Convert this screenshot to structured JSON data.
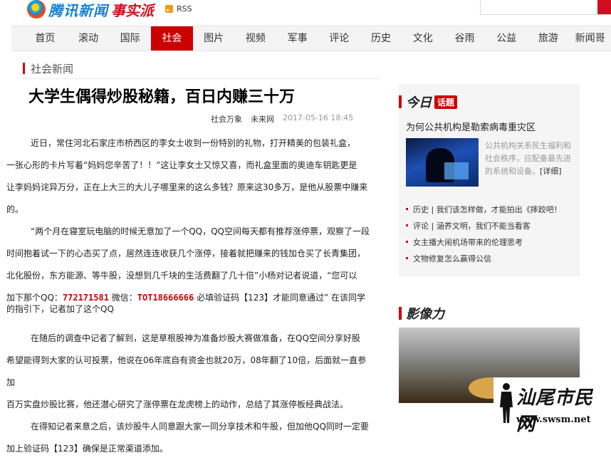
{
  "header": {
    "logo_text": "腾讯新闻",
    "logo_sub": "事实派",
    "rss_label": "RSS"
  },
  "nav": {
    "items": [
      "首页",
      "滚动",
      "国际",
      "社会",
      "图片",
      "视频",
      "军事",
      "评论",
      "历史",
      "文化",
      "谷雨",
      "公益",
      "旅游",
      "新闻哥"
    ],
    "active": "社会"
  },
  "section": {
    "title": "社会新闻"
  },
  "article": {
    "headline": "大学生偶得炒股秘籍，百日内赚三十万",
    "source": "社会万象",
    "source2": "未来网",
    "time": "2017-05-16 18:45",
    "p1": "近日，常住河北石家庄市桥西区的李女士收到一份特别的礼物，打开精美的包装礼盒，",
    "p1b": "一张心形的卡片写着“妈妈您辛苦了！！”这让李女士又惊又喜，而礼盒里面的奥迪车钥匙更是",
    "p1c": "让李妈妈诧异万分，正在上大三的大儿子哪里来的这么多钱？原来这30多万，是他从股票中赚来",
    "p1d": "的。",
    "p2": "“两个月在寝室玩电脑的时候无意加了一个QQ，QQ空间每天都有推荐涨停票，观察了一段",
    "p2b": "时间抱着试一下的心态买了点，居然连连收获几个涨停，接着就把赚来的钱加仓买了长青集团，",
    "p2c": "北化股份，东方能源、等牛股，没想到几千块的生活费翻了几十倍”小杨对记者说道，“您可以",
    "p2d_pre": "加下那个QQ：",
    "qq": "772171581",
    "p2d_mid": " 微信：",
    "wechat": "TOT18666666",
    "p2d_post": " 必填验证码【123】才能同意通过”  在该同学",
    "p2e": "的指引下，记者加了这个QQ",
    "p3": "在随后的调查中记者了解到，这是草根股神为准备炒股大赛做准备，在QQ空间分享好股",
    "p3b": "希望能得到大家的认可投票，他说在06年底自有资金也就20万，08年翻了10倍，后面就一直参加",
    "p3c": "百万实盘炒股比赛，他还潜心研究了涨停票在龙虎榜上的动作，总结了其涨停板经典战法。",
    "p4": "在得知记者来意之后，该炒股牛人同意跟大家一同分享技术和牛股，但加他QQ同时一定要",
    "p4b": "加上验证码【123】确保是正常渠道添加。"
  },
  "today": {
    "title": "今日",
    "tag": "话题",
    "headline": "为何公共机构是勒索病毒重灾区",
    "desc": "公共机构关系民生福利和社会秩序，应配备最先进的系统和设备。",
    "more": "[详细]",
    "links": [
      "历史 | 我们该怎样做，才能拍出《摔跤吧！",
      "评论 | 涵养文明，我们不能当看客",
      "女主播大闹机场带来的伦理思考",
      "文物修复怎么赢得公信"
    ]
  },
  "impact": {
    "title": "影像力"
  },
  "watermark": {
    "text": "汕尾市民网",
    "url": "www.swsm.net"
  },
  "colors": {
    "accent": "#cc0000",
    "link": "#1480d6"
  }
}
